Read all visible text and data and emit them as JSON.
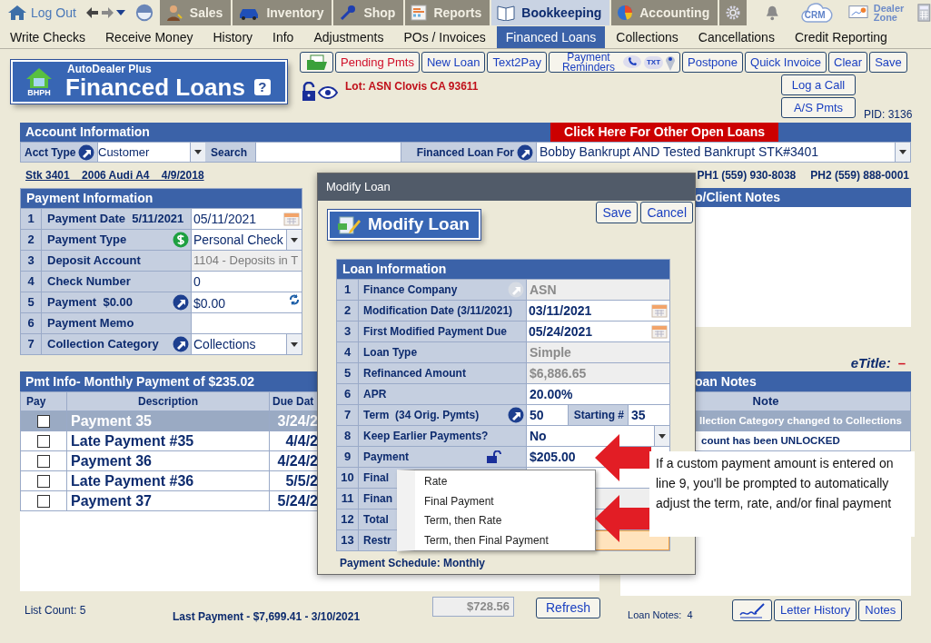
{
  "top_nav": {
    "logout": "Log Out",
    "tabs": [
      {
        "label": "Sales",
        "selected": false
      },
      {
        "label": "Inventory",
        "selected": false
      },
      {
        "label": "Shop",
        "selected": false
      },
      {
        "label": "Reports",
        "selected": false
      },
      {
        "label": "Bookkeeping",
        "selected": true
      },
      {
        "label": "Accounting",
        "selected": false
      }
    ],
    "crm": "CRM",
    "dealer_zone": "Dealer Zone"
  },
  "menu": [
    {
      "label": "Write Checks",
      "selected": false
    },
    {
      "label": "Receive Money",
      "selected": false
    },
    {
      "label": "History",
      "selected": false
    },
    {
      "label": "Info",
      "selected": false
    },
    {
      "label": "Adjustments",
      "selected": false
    },
    {
      "label": "POs / Invoices",
      "selected": false
    },
    {
      "label": "Financed Loans",
      "selected": true
    },
    {
      "label": "Collections",
      "selected": false
    },
    {
      "label": "Cancellations",
      "selected": false
    },
    {
      "label": "Credit Reporting",
      "selected": false
    }
  ],
  "header": {
    "logo_text": "BHPH",
    "app_name": "AutoDealer Plus",
    "title": "Financed Loans",
    "help": "?",
    "lot": "Lot: ASN Clovis CA 93611",
    "pid": "PID: 3136"
  },
  "toolbar": [
    {
      "kind": "folder"
    },
    {
      "kind": "alert",
      "label": "Pending Pmts"
    },
    {
      "kind": "text",
      "label": "New Loan"
    },
    {
      "kind": "text",
      "label": "Text2Pay"
    },
    {
      "kind": "reminders",
      "label": "Payment Reminders",
      "badge": "TXT"
    },
    {
      "kind": "text",
      "label": "Postpone"
    },
    {
      "kind": "text",
      "label": "Quick Invoice"
    },
    {
      "kind": "text",
      "label": "Clear"
    },
    {
      "kind": "text",
      "label": "Save"
    }
  ],
  "side_buttons": [
    "Log a Call",
    "A/S Pmts"
  ],
  "account": {
    "title": "Account Information",
    "other_loans": "Click Here For Other Open Loans",
    "acct_type_label": "Acct Type",
    "acct_type": "Customer",
    "search_label": "Search",
    "loan_for_label": "Financed Loan For",
    "loan_for": "Bobby Bankrupt AND Tested Bankrupt STK#3401",
    "stock_line": "Stk 3401    2006 Audi A4    4/9/2018",
    "phones": [
      "PH1 (559) 930-8038",
      "PH2 (559) 888-0001"
    ]
  },
  "payment_info": {
    "title": "Payment Information",
    "rows": [
      {
        "num": "1",
        "label": "Payment Date  5/11/2021",
        "kind": "date",
        "value": "05/11/2021",
        "lookup": false
      },
      {
        "num": "2",
        "label": "Payment Type",
        "kind": "payment-type",
        "value": "Personal Check",
        "lookup": false
      },
      {
        "num": "3",
        "label": "Deposit Account",
        "kind": "readonly",
        "value": "1104 - Deposits in T",
        "lookup": false
      },
      {
        "num": "4",
        "label": "Check Number",
        "kind": "text",
        "value": "0",
        "lookup": false
      },
      {
        "num": "5",
        "label": "Payment  $0.00",
        "kind": "amount",
        "value": "$0.00",
        "lookup": true
      },
      {
        "num": "6",
        "label": "Payment Memo",
        "kind": "text",
        "lookup": false
      },
      {
        "num": "7",
        "label": "Collection Category",
        "kind": "select",
        "value": "Collections",
        "lookup": true
      }
    ]
  },
  "client_notes": {
    "title": "o/Client Notes"
  },
  "etitle": {
    "label": "eTitle:",
    "value": "–"
  },
  "payments": {
    "title": "Pmt Info- Monthly Payment of $235.02",
    "columns": [
      "Pay",
      "Description",
      "Due Dat"
    ],
    "rows": [
      {
        "checked": false,
        "selected": true,
        "description": "Payment 35",
        "due": "3/24/2"
      },
      {
        "checked": false,
        "selected": false,
        "description": "Late Payment #35",
        "due": "4/4/2"
      },
      {
        "checked": false,
        "selected": false,
        "description": "Payment 36",
        "due": "4/24/2"
      },
      {
        "checked": false,
        "selected": false,
        "description": "Late Payment #36",
        "due": "5/5/2"
      },
      {
        "checked": false,
        "selected": false,
        "description": "Payment 37",
        "due": "5/24/2"
      }
    ],
    "list_count": "List Count:  5",
    "last_payment": "Last Payment - $7,699.41 - 3/10/2021",
    "total": "$728.56",
    "refresh": "Refresh"
  },
  "loan_notes": {
    "title": "oan Notes",
    "column": "Note",
    "rows": [
      {
        "text": "llection Category changed to Collections",
        "selected": true
      },
      {
        "text": "count has been UNLOCKED",
        "selected": false
      }
    ],
    "count": "Loan Notes:  4",
    "buttons": [
      {
        "kind": "signature"
      },
      {
        "kind": "text",
        "label": "Letter History"
      },
      {
        "kind": "text",
        "label": "Notes"
      }
    ]
  },
  "modal": {
    "title": "Modify Loan",
    "banner": "Modify Loan",
    "buttons": [
      "Save",
      "Cancel"
    ],
    "table_title": "Loan Information",
    "rows": [
      {
        "num": "1",
        "label": "Finance Company",
        "kind": "text",
        "value": "ASN",
        "lookup": true,
        "disabled": true
      },
      {
        "num": "2",
        "label": "Modification Date (3/11/2021)",
        "kind": "date",
        "value": "03/11/2021",
        "lookup": false,
        "disabled": false
      },
      {
        "num": "3",
        "label": "First Modified Payment Due",
        "kind": "date",
        "value": "05/24/2021",
        "lookup": false,
        "disabled": false
      },
      {
        "num": "4",
        "label": "Loan Type",
        "kind": "text",
        "value": "Simple",
        "lookup": false,
        "disabled": true
      },
      {
        "num": "5",
        "label": "Refinanced Amount",
        "kind": "text",
        "value": "$6,886.65",
        "lookup": false,
        "disabled": true
      },
      {
        "num": "6",
        "label": "APR",
        "kind": "text",
        "value": "20.00%",
        "lookup": false,
        "disabled": false
      },
      {
        "num": "7",
        "label": "Term  (34 Orig. Pymts)",
        "kind": "term",
        "value": "50",
        "starting_label": "Starting #",
        "starting": "35",
        "lookup": true,
        "disabled": false
      },
      {
        "num": "8",
        "label": "Keep Earlier Payments?",
        "kind": "select",
        "value": "No",
        "lookup": false,
        "disabled": false
      },
      {
        "num": "9",
        "label": "Payment",
        "kind": "locked",
        "value": "$205.00",
        "lookup": false,
        "disabled": false
      },
      {
        "num": "10",
        "label": "Final",
        "kind": "text",
        "lookup": false,
        "disabled": false
      },
      {
        "num": "11",
        "label": "Finan",
        "kind": "text",
        "lookup": false,
        "disabled": true
      },
      {
        "num": "12",
        "label": "Total",
        "kind": "text",
        "lookup": false,
        "disabled": true
      },
      {
        "num": "13",
        "label": "Restr",
        "kind": "highlight",
        "lookup": false,
        "disabled": false
      }
    ],
    "schedule": "Payment Schedule: Monthly"
  },
  "context_menu": {
    "items": [
      "Rate",
      "Final Payment",
      "Term, then Rate",
      "Term, then Final Payment"
    ]
  },
  "callout": {
    "text": "If a custom payment amount is entered on line 9, you'll be prompted to automatically adjust the term, rate, and/or final payment"
  }
}
